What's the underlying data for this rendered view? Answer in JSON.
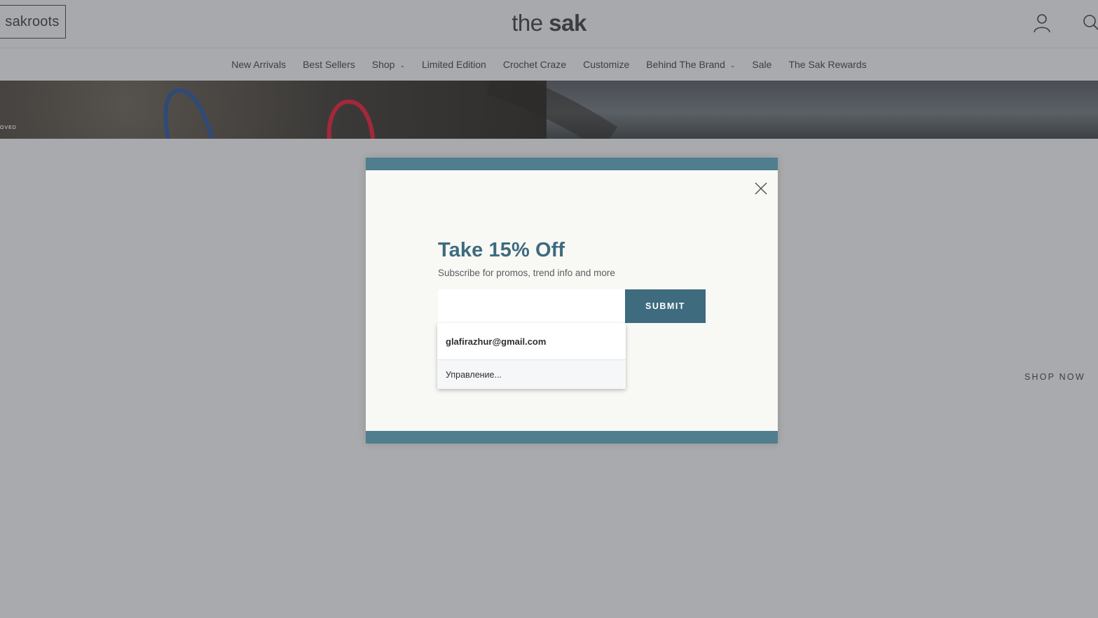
{
  "header": {
    "sakroots_label_bold": "sak",
    "sakroots_label_rest": "roots",
    "logo_prefix": "the ",
    "logo_bold": "sak",
    "account_icon": "user-icon",
    "search_icon": "search-icon"
  },
  "nav": {
    "items": [
      {
        "label": "New Arrivals",
        "has_dropdown": false
      },
      {
        "label": "Best Sellers",
        "has_dropdown": false
      },
      {
        "label": "Shop",
        "has_dropdown": true
      },
      {
        "label": "Limited Edition",
        "has_dropdown": false
      },
      {
        "label": "Crochet Craze",
        "has_dropdown": false
      },
      {
        "label": "Customize",
        "has_dropdown": false
      },
      {
        "label": "Behind The Brand",
        "has_dropdown": true
      },
      {
        "label": "Sale",
        "has_dropdown": false
      },
      {
        "label": "The Sak Rewards",
        "has_dropdown": false
      }
    ]
  },
  "hero": {
    "partial_text": "OVED"
  },
  "modal": {
    "headline": "Take 15% Off",
    "subline": "Subscribe for promos, trend info and more",
    "email_value": "",
    "submit_label": "SUBMIT",
    "accent_color": "#4f7e8f",
    "close_icon": "close-icon"
  },
  "autofill": {
    "suggestion": "glafirazhur@gmail.com",
    "manage_label": "Управление..."
  },
  "page": {
    "shop_now_label": "SHOP NOW"
  }
}
